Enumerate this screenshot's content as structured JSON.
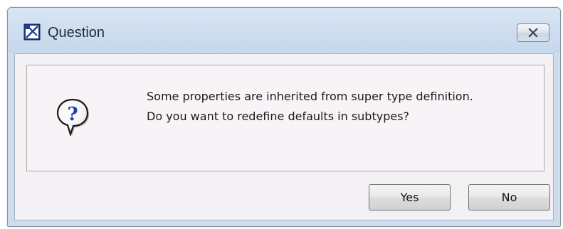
{
  "dialog": {
    "title": "Question",
    "title_icon": "app-logo-icon",
    "close_icon": "close-icon",
    "message_icon": "question-icon",
    "message_lines": [
      "Some properties are inherited from super type definition.",
      "Do you want to redefine defaults in subtypes?"
    ],
    "buttons": {
      "yes_label": "Yes",
      "no_label": "No"
    },
    "colors": {
      "titlebar": "#cddcef",
      "client_background": "#f4f1f4",
      "question_mark": "#1a3db5"
    }
  }
}
